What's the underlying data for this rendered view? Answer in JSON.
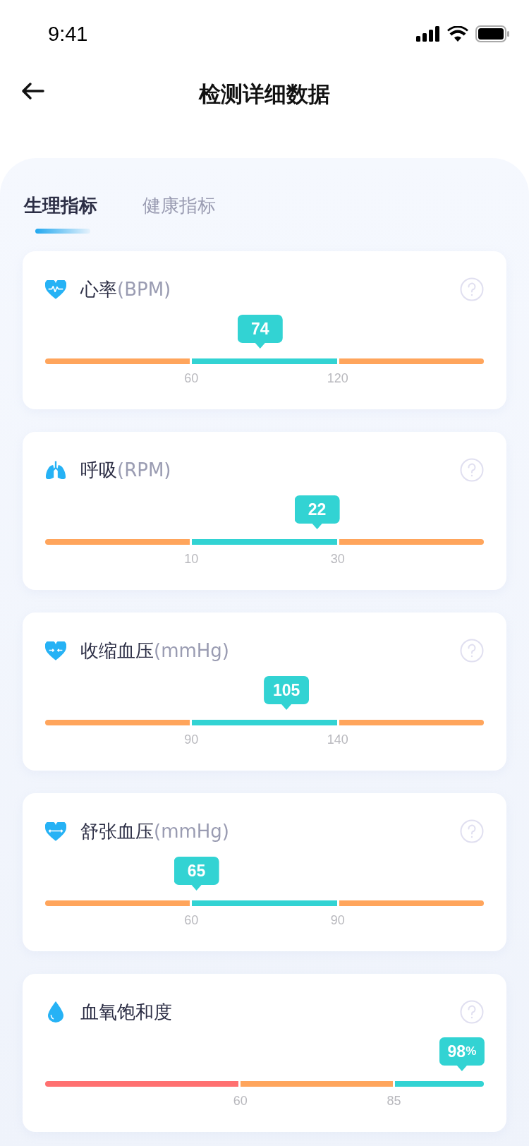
{
  "status_bar": {
    "time": "9:41"
  },
  "header": {
    "title": "检测详细数据"
  },
  "tabs": [
    {
      "label": "生理指标",
      "selected": true
    },
    {
      "label": "健康指标",
      "selected": false
    }
  ],
  "metrics": [
    {
      "kind": "heart-rate",
      "name": "心率",
      "unit": "(BPM)",
      "value": "74",
      "level": 0.49,
      "segments": [
        {
          "color": "#ffa55c"
        },
        {
          "color": "#32d3d3"
        },
        {
          "color": "#ffa55c"
        }
      ],
      "ticks": [
        "60",
        "120"
      ]
    },
    {
      "kind": "respiration",
      "name": "呼吸",
      "unit": "(RPM)",
      "value": "22",
      "level": 0.62,
      "segments": [
        {
          "color": "#ffa55c"
        },
        {
          "color": "#32d3d3"
        },
        {
          "color": "#ffa55c"
        }
      ],
      "ticks": [
        "10",
        "30"
      ]
    },
    {
      "kind": "systolic",
      "name": "收缩血压",
      "unit": "(mmHg)",
      "value": "105",
      "level": 0.55,
      "segments": [
        {
          "color": "#ffa55c"
        },
        {
          "color": "#32d3d3"
        },
        {
          "color": "#ffa55c"
        }
      ],
      "ticks": [
        "90",
        "140"
      ]
    },
    {
      "kind": "diastolic",
      "name": "舒张血压",
      "unit": "(mmHg)",
      "value": "65",
      "level": 0.345,
      "segments": [
        {
          "color": "#ffa55c"
        },
        {
          "color": "#32d3d3"
        },
        {
          "color": "#ffa55c"
        }
      ],
      "ticks": [
        "60",
        "90"
      ]
    },
    {
      "kind": "oxygen",
      "name": "血氧饱和度",
      "value": "98",
      "value_suffix": "%",
      "level": 0.95,
      "segments": [
        {
          "color": "#ff7070"
        },
        {
          "color": "#ffa55c"
        },
        {
          "color": "#32d3d3"
        }
      ],
      "ticks": [
        "60",
        "85"
      ]
    }
  ]
}
